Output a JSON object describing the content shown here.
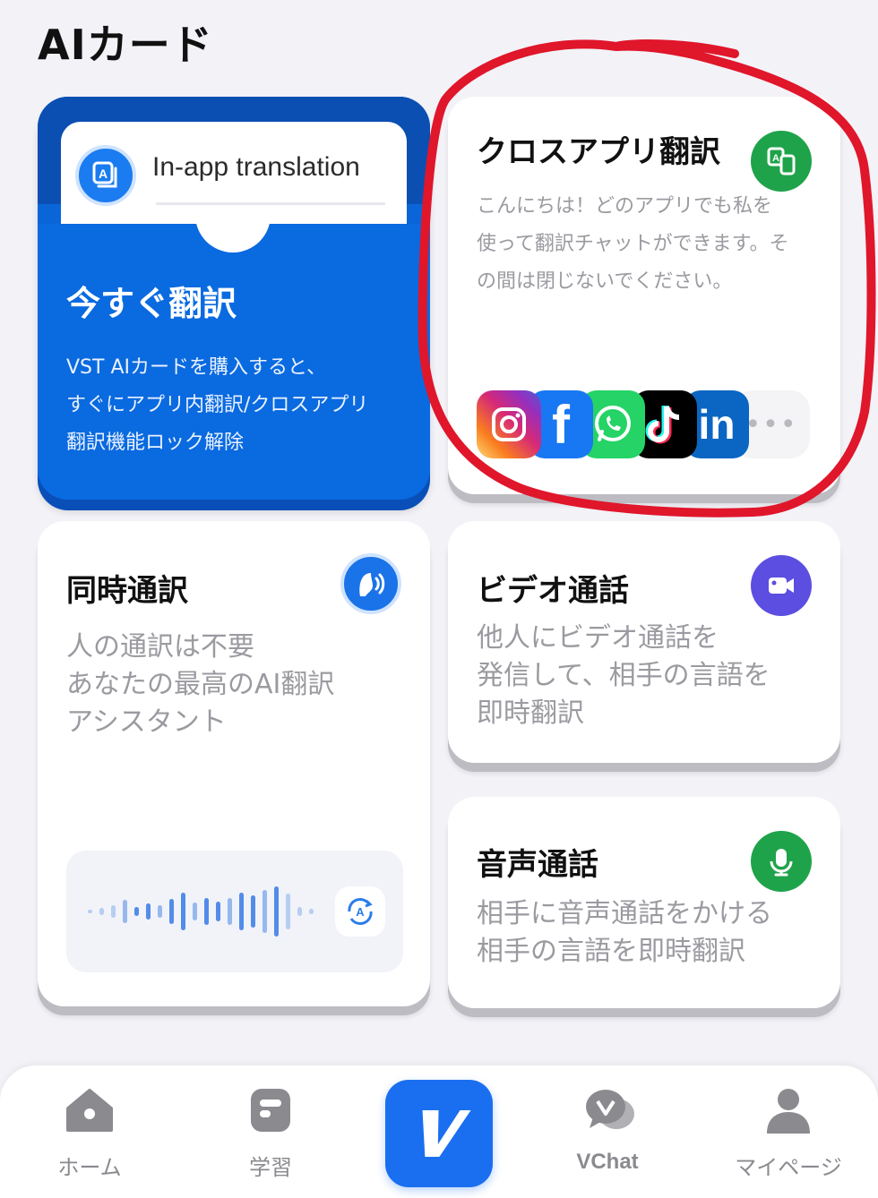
{
  "page": {
    "title": "AIカード"
  },
  "blue_card": {
    "in_app_label": "In-app translation",
    "title": "今すぐ翻訳",
    "description_lines": [
      "VST AIカードを購入すると、",
      "すぐにアプリ内翻訳/クロスアプリ",
      "翻訳機能ロック解除"
    ]
  },
  "cross_app_card": {
    "title": "クロスアプリ翻訳",
    "description_lines": [
      "こんにちは！どのアプリでも私を",
      "使って翻訳チャットができます。そ",
      "の間は閉じないでください。"
    ],
    "apps": [
      "instagram",
      "facebook",
      "whatsapp",
      "tiktok",
      "linkedin"
    ],
    "more_label": "•••",
    "icon": "cross-app-translate-icon",
    "icon_color": "#1fa34a"
  },
  "simul_card": {
    "title": "同時通訳",
    "description_lines": [
      "人の通訳は不要",
      "あなたの最高のAI翻訳",
      "アシスタント"
    ],
    "icon": "voice-head-icon",
    "icon_color": "#1a73e8"
  },
  "video_card": {
    "title": "ビデオ通話",
    "description_lines": [
      "他人にビデオ通話を",
      "発信して、相手の言語を",
      "即時翻訳"
    ],
    "icon": "video-camera-icon",
    "icon_color": "#5b4ee0"
  },
  "voice_card": {
    "title": "音声通話",
    "description_lines": [
      "相手に音声通話をかける",
      "相手の言語を即時翻訳"
    ],
    "icon": "microphone-icon",
    "icon_color": "#1fa34a"
  },
  "nav": {
    "items": [
      {
        "label": "ホーム",
        "icon": "home-icon"
      },
      {
        "label": "学習",
        "icon": "study-icon"
      },
      {
        "label": "",
        "icon": "v-logo-icon"
      },
      {
        "label": "VChat",
        "icon": "chat-icon"
      },
      {
        "label": "マイページ",
        "icon": "profile-icon"
      }
    ]
  },
  "colors": {
    "accent_blue": "#0a66d8",
    "annotation_red": "#e0162b"
  }
}
